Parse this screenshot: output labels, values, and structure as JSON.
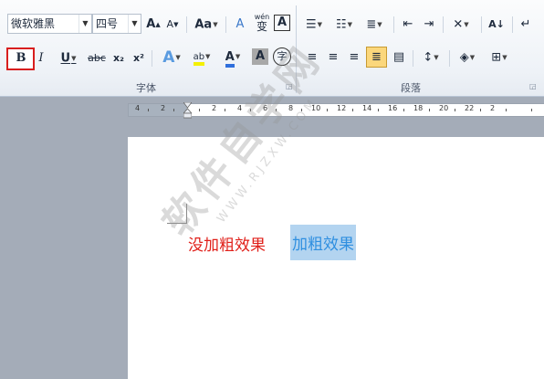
{
  "font_group": {
    "label": "字体",
    "font_name": "微软雅黑",
    "font_size": "四号",
    "bold": "B",
    "italic": "I",
    "underline": "U",
    "strikethrough": "abc",
    "subscript": "x₂",
    "superscript": "x²",
    "grow_font": "A",
    "shrink_font": "A",
    "change_case": "Aa",
    "clear_format": "A",
    "phonetic_top": "wén",
    "phonetic_char": "变",
    "char_border": "A",
    "text_effect": "A",
    "highlight": "ab",
    "font_color": "A",
    "char_shading": "A",
    "enclose_char": "字"
  },
  "paragraph_group": {
    "label": "段落",
    "sort": "A↓"
  },
  "ruler": {
    "labels": [
      "4",
      "2",
      "2",
      "4",
      "6",
      "8",
      "10",
      "12",
      "14",
      "16",
      "18",
      "20",
      "22",
      "2"
    ]
  },
  "document": {
    "text_normal": "没加粗效果",
    "text_selected": "加粗效果"
  },
  "watermark": {
    "big": "软件自学网",
    "small": "WWW.RJZXW.COM"
  },
  "colors": {
    "text_red": "#e0201a",
    "text_blue": "#2f8fe0",
    "selection": "#b3d4f0",
    "highlight_box": "#d81e1e",
    "active_align": "#fbd77c"
  }
}
